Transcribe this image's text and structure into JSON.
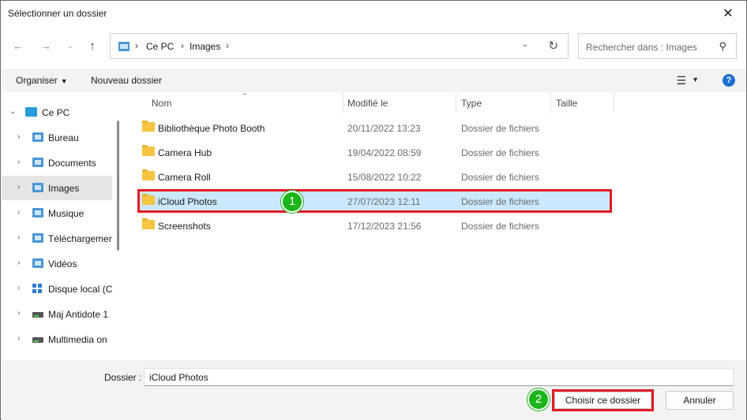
{
  "window": {
    "title": "Sélectionner un dossier"
  },
  "address": {
    "crumbs": [
      "Ce PC",
      "Images"
    ]
  },
  "search": {
    "placeholder": "Rechercher dans : Images"
  },
  "toolbar": {
    "organize": "Organiser",
    "new_folder": "Nouveau dossier",
    "help": "?"
  },
  "sidebar": {
    "items": [
      {
        "label": "Ce PC",
        "icon": "pc-icon"
      },
      {
        "label": "Bureau",
        "icon": "desktop-folder-icon"
      },
      {
        "label": "Documents",
        "icon": "documents-folder-icon"
      },
      {
        "label": "Images",
        "icon": "pictures-folder-icon"
      },
      {
        "label": "Musique",
        "icon": "music-folder-icon"
      },
      {
        "label": "Téléchargemen",
        "icon": "downloads-folder-icon"
      },
      {
        "label": "Vidéos",
        "icon": "videos-folder-icon"
      },
      {
        "label": "Disque local (C",
        "icon": "windows-drive-icon"
      },
      {
        "label": "Maj Antidote 1",
        "icon": "drive-icon"
      },
      {
        "label": "Multimedia on",
        "icon": "drive-icon"
      }
    ]
  },
  "columns": {
    "name": "Nom",
    "modified": "Modifié le",
    "type": "Type",
    "size": "Taille"
  },
  "files": [
    {
      "name": "Bibliothèque Photo Booth",
      "modified": "20/11/2022 13:23",
      "type": "Dossier de fichiers"
    },
    {
      "name": "Camera Hub",
      "modified": "19/04/2022 08:59",
      "type": "Dossier de fichiers"
    },
    {
      "name": "Camera Roll",
      "modified": "15/08/2022 10:22",
      "type": "Dossier de fichiers"
    },
    {
      "name": "iCloud Photos",
      "modified": "27/07/2023 12:11",
      "type": "Dossier de fichiers"
    },
    {
      "name": "Screenshots",
      "modified": "17/12/2023 21:56",
      "type": "Dossier de fichiers"
    }
  ],
  "annotations": {
    "step1": "1",
    "step2": "2"
  },
  "footer": {
    "folder_label": "Dossier :",
    "folder_value": "iCloud Photos",
    "choose_button": "Choisir ce dossier",
    "cancel_button": "Annuler"
  },
  "colors": {
    "selection": "#cce8ff",
    "highlight": "#e11b22",
    "badge": "#1bb51b",
    "accent": "#1e6ed1"
  }
}
